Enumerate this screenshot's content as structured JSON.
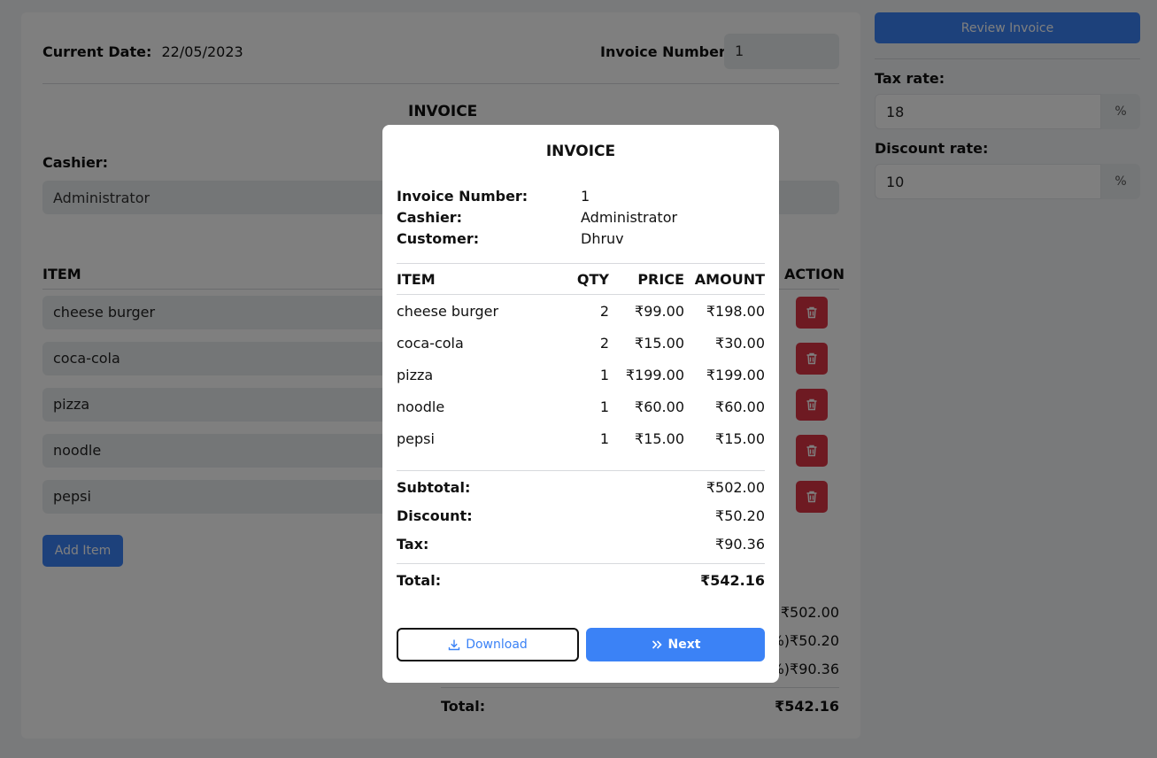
{
  "form": {
    "current_date_label": "Current Date:",
    "current_date_value": "22/05/2023",
    "invoice_number_label": "Invoice Number:",
    "invoice_number_value": "1",
    "title": "INVOICE",
    "cashier_label": "Cashier:",
    "cashier_value": "Administrator",
    "item_header": "ITEM",
    "action_header": "ACTION",
    "items": [
      "cheese burger",
      "coca-cola",
      "pizza",
      "noodle",
      "pepsi"
    ],
    "add_item_label": "Add Item",
    "subtotal_value": "₹502.00",
    "discount_value": "%)₹50.20",
    "tax_value": "%)₹90.36",
    "total_label": "Total:",
    "total_value": "₹542.16"
  },
  "sidebar": {
    "review_button": "Review Invoice",
    "tax_rate_label": "Tax rate:",
    "tax_rate_value": "18",
    "tax_suffix": "%",
    "discount_rate_label": "Discount rate:",
    "discount_rate_value": "10",
    "discount_suffix": "%"
  },
  "modal": {
    "title": "INVOICE",
    "info": [
      {
        "label": "Invoice Number:",
        "value": "1"
      },
      {
        "label": "Cashier:",
        "value": "Administrator"
      },
      {
        "label": "Customer:",
        "value": "Dhruv"
      }
    ],
    "columns": [
      "ITEM",
      "QTY",
      "PRICE",
      "AMOUNT"
    ],
    "rows": [
      {
        "item": "cheese burger",
        "qty": "2",
        "price": "₹99.00",
        "amount": "₹198.00"
      },
      {
        "item": "coca-cola",
        "qty": "2",
        "price": "₹15.00",
        "amount": "₹30.00"
      },
      {
        "item": "pizza",
        "qty": "1",
        "price": "₹199.00",
        "amount": "₹199.00"
      },
      {
        "item": "noodle",
        "qty": "1",
        "price": "₹60.00",
        "amount": "₹60.00"
      },
      {
        "item": "pepsi",
        "qty": "1",
        "price": "₹15.00",
        "amount": "₹15.00"
      }
    ],
    "subtotal_label": "Subtotal:",
    "subtotal_value": "₹502.00",
    "discount_label": "Discount:",
    "discount_value": "₹50.20",
    "tax_label": "Tax:",
    "tax_value": "₹90.36",
    "total_label": "Total:",
    "total_value": "₹542.16",
    "download_label": "Download",
    "next_label": "Next"
  },
  "colors": {
    "primary": "#3b82f6",
    "danger": "#dc3545"
  }
}
